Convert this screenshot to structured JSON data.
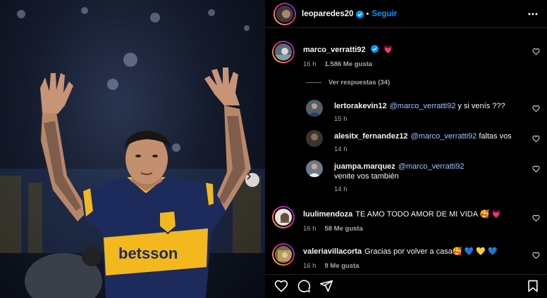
{
  "post": {
    "author": "leoparedes20",
    "follow_label": "Seguir"
  },
  "photo": {
    "jersey_sponsor": "betsson"
  },
  "comments": [
    {
      "user": "marco_verratti92",
      "verified": true,
      "text": "",
      "emoji": "💗",
      "time": "16 h",
      "likes": "1.586 Me gusta",
      "view_replies": "Ver respuestas (34)"
    },
    {
      "user": "lertorakevin12",
      "mention": "@marco_verratti92",
      "text": " y si venís ???",
      "time": "15 h"
    },
    {
      "user": "alesitx_fernandez12",
      "mention": "@marco_verratti92",
      "text": " faltas vos",
      "time": "14 h"
    },
    {
      "user": "juampa.marquez",
      "mention": "@marco_verratti92",
      "text": " venite vos también",
      "time": "14 h"
    },
    {
      "user": "luulimendoza",
      "text": "TE AMO TODO AMOR DE MI VIDA 🥰 💗",
      "time": "16 h",
      "likes": "58 Me gusta"
    },
    {
      "user": "valeriavillacorta",
      "text": "Gracias por volver a casa🥰 💙 💛 💙",
      "time": "16 h",
      "likes": "9 Me gusta"
    }
  ],
  "icons": {
    "more": "more-options-icon",
    "like": "heart-icon",
    "comment": "comment-icon",
    "share": "share-icon",
    "save": "bookmark-icon",
    "next": "chevron-right-icon"
  },
  "colors": {
    "link_blue": "#0095f6",
    "jersey_navy": "#1d2a5c",
    "jersey_gold": "#f2b81e"
  }
}
